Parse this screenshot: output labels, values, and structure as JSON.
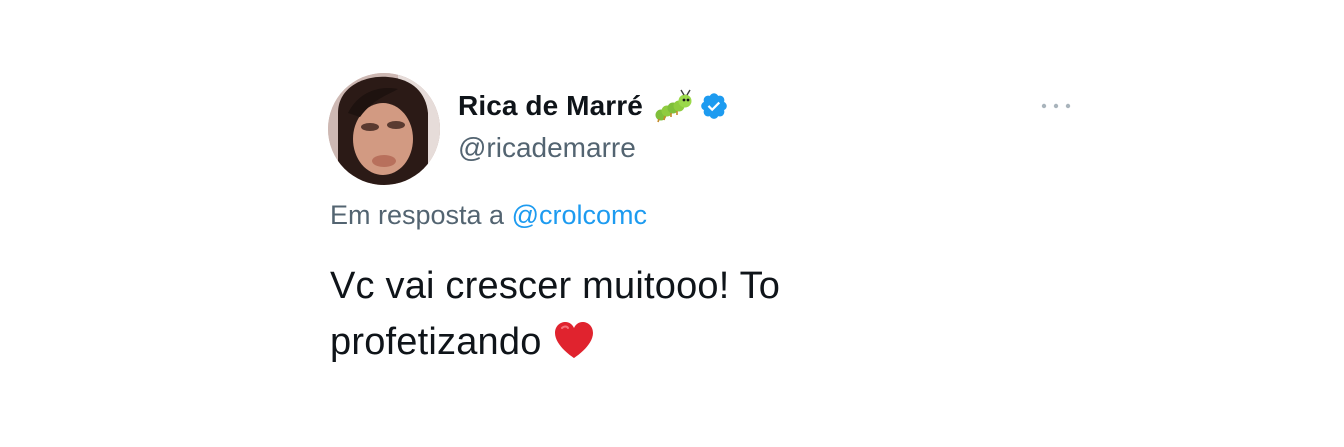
{
  "author": {
    "display_name": "Rica de Marré",
    "handle": "@ricademarre",
    "name_emoji": "caterpillar-emoji",
    "verified": true,
    "verified_color": "#1d9bf0"
  },
  "reply": {
    "prefix": "Em resposta a",
    "mention": "@crolcomc",
    "mention_color": "#1d9bf0"
  },
  "tweet": {
    "line1": "Vc vai crescer muitooo! To",
    "line2": "profetizando",
    "trailing_emoji": "red-heart-emoji"
  },
  "menu": {
    "icon": "more-options-icon"
  }
}
